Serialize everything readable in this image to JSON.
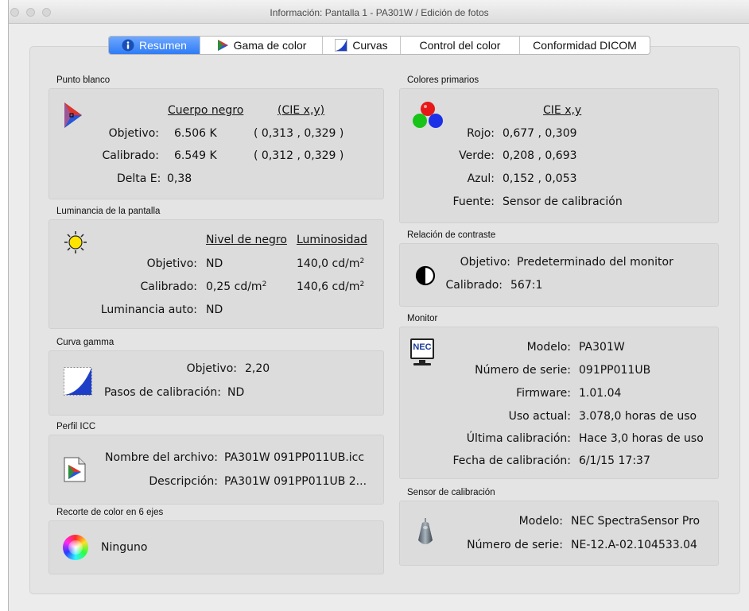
{
  "window": {
    "title": "Información: Pantalla 1 - PA301W / Edición de fotos"
  },
  "tabs": [
    {
      "label": "Resumen",
      "icon": "info-icon",
      "active": true
    },
    {
      "label": "Gama de color",
      "icon": "gamut-icon",
      "active": false
    },
    {
      "label": "Curvas",
      "icon": "curves-icon",
      "active": false
    },
    {
      "label": "Control del color",
      "icon": "",
      "active": false
    },
    {
      "label": "Conformidad DICOM",
      "icon": "",
      "active": false
    }
  ],
  "white_point": {
    "section_title": "Punto blanco",
    "col1_header": "Cuerpo negro",
    "col2_header": "(CIE x,y)",
    "target_label": "Objetivo:",
    "target_kelvin": "6.506 K",
    "target_xy": "( 0,313 , 0,329 )",
    "calibrated_label": "Calibrado:",
    "calibrated_kelvin": "6.549 K",
    "calibrated_xy": "( 0,312 , 0,329 )",
    "delta_label": "Delta E:",
    "delta_value": "0,38"
  },
  "primaries": {
    "section_title": "Colores primarios",
    "header": "CIE x,y",
    "red_label": "Rojo:",
    "red_value": "0,677 , 0,309",
    "green_label": "Verde:",
    "green_value": "0,208 , 0,693",
    "blue_label": "Azul:",
    "blue_value": "0,152 , 0,053",
    "source_label": "Fuente:",
    "source_value": "Sensor de calibración"
  },
  "luminance": {
    "section_title": "Luminancia de la pantalla",
    "col1_header": "Nivel de negro",
    "col2_header": "Luminosidad",
    "target_label": "Objetivo:",
    "target_black": "ND",
    "target_lum": "140,0 cd/m",
    "calibrated_label": "Calibrado:",
    "calibrated_black": "0,25 cd/m",
    "calibrated_lum": "140,6 cd/m",
    "unit_sup": "2",
    "auto_label": "Luminancia auto:",
    "auto_value": "ND"
  },
  "contrast": {
    "section_title": "Relación de contraste",
    "target_label": "Objetivo:",
    "target_value": "Predeterminado del monitor",
    "calibrated_label": "Calibrado:",
    "calibrated_value": "567:1"
  },
  "gamma": {
    "section_title": "Curva gamma",
    "target_label": "Objetivo:",
    "target_value": "2,20",
    "steps_label": "Pasos de calibración:",
    "steps_value": "ND"
  },
  "monitor": {
    "section_title": "Monitor",
    "logo_text": "NEC",
    "model_label": "Modelo:",
    "model_value": "PA301W",
    "serial_label": "Número de serie:",
    "serial_value": "091PP011UB",
    "firmware_label": "Firmware:",
    "firmware_value": "1.01.04",
    "usage_label": "Uso actual:",
    "usage_value": "3.078,0 horas de uso",
    "last_cal_label": "Última calibración:",
    "last_cal_value": "Hace 3,0 horas de uso",
    "cal_date_label": "Fecha de calibración:",
    "cal_date_value": "6/1/15 17:37"
  },
  "icc": {
    "section_title": "Perfil ICC",
    "file_label": "Nombre del archivo:",
    "file_value": "PA301W 091PP011UB.icc",
    "desc_label": "Descripción:",
    "desc_value": "PA301W 091PP011UB 2..."
  },
  "sensor": {
    "section_title": "Sensor de calibración",
    "model_label": "Modelo:",
    "model_value": "NEC SpectraSensor Pro",
    "serial_label": "Número de serie:",
    "serial_value": "NE-12.A-02.104533.04"
  },
  "clip": {
    "section_title": "Recorte de color en 6 ejes",
    "value": "Ninguno"
  }
}
